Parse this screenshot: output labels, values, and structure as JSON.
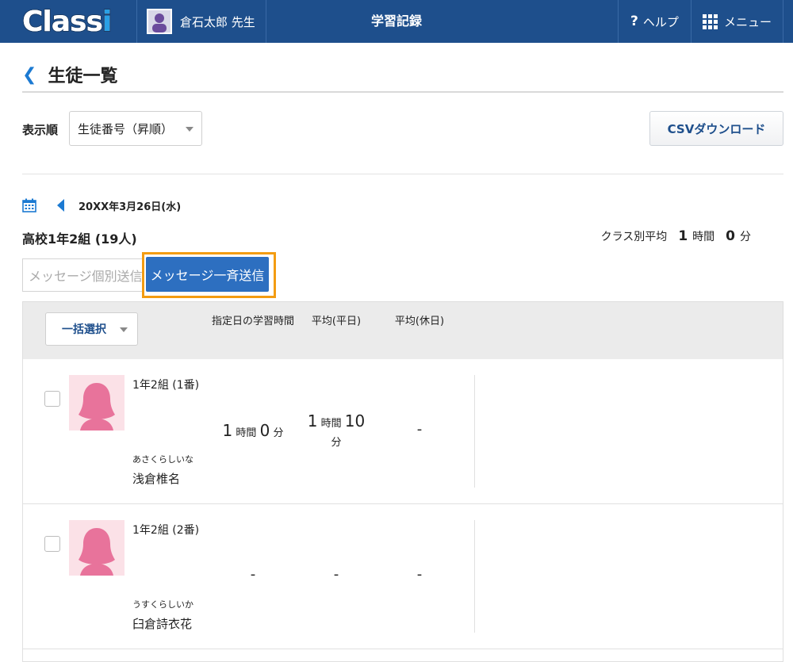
{
  "header": {
    "logo_text": "Class",
    "logo_i": "i",
    "user_name": "倉石太郎 先生",
    "title": "学習記録",
    "help_icon": "question-icon",
    "help_label": "ヘルプ",
    "menu_icon": "grid-icon",
    "menu_label": "メニュー",
    "brand_color": "#1e4f8c"
  },
  "page": {
    "section_title": "生徒一覧",
    "sort_label": "表示順",
    "sort_value": "生徒番号（昇順）",
    "csv_button": "CSVダウンロード",
    "date": "20XX年3月26日(水)",
    "class_name": "高校1年2組 (19人)",
    "class_avg_label": "クラス別平均",
    "class_avg_hours": "1",
    "class_avg_hours_unit": "時間",
    "class_avg_minutes": "0",
    "class_avg_minutes_unit": "分",
    "msg_individual": "メッセージ個別送信",
    "msg_all": "メッセージ一斉送信",
    "highlight_color": "#f39c12"
  },
  "table": {
    "bulk_select": "一括選択",
    "col_study_time": "指定日の学習時間",
    "col_weekday_avg": "平均(平日)",
    "col_holiday_avg": "平均(休日)"
  },
  "students": [
    {
      "class": "1年2組 (1番)",
      "kana": "あさくらしいな",
      "name": "浅倉椎名",
      "study_hours": "1",
      "study_minutes": "0",
      "weekday_hours": "1",
      "weekday_minutes": "10",
      "holiday": "-",
      "hour_unit": "時間",
      "minute_unit": "分"
    },
    {
      "class": "1年2組 (2番)",
      "kana": "うすくらしいか",
      "name": "臼倉詩衣花",
      "study": "-",
      "weekday": "-",
      "holiday": "-"
    }
  ]
}
